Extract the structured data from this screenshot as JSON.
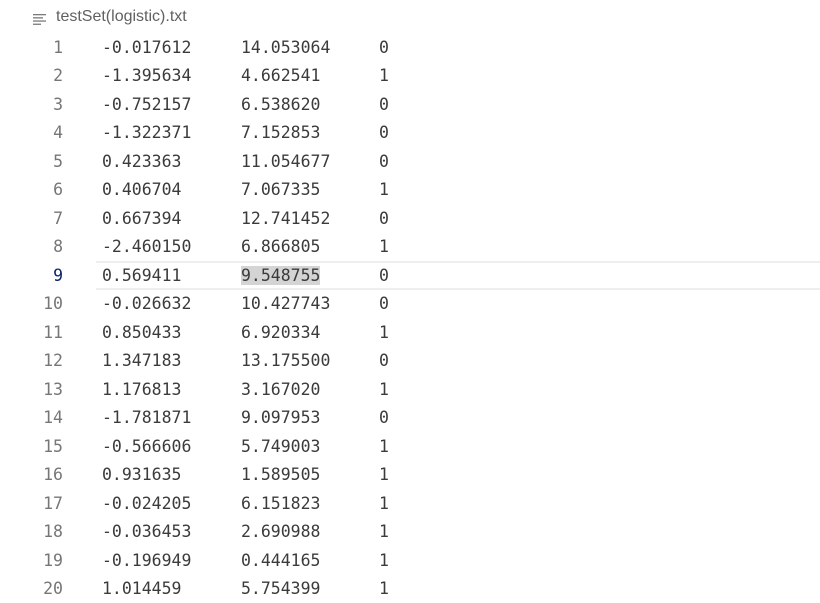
{
  "breadcrumb": {
    "icon": "text-lines-icon",
    "filename": "testSet(logistic).txt"
  },
  "editor": {
    "current_line": 9,
    "selection": "9.548755",
    "lines": [
      {
        "n": "1",
        "a": "-0.017612",
        "b": "14.053064",
        "c": "0"
      },
      {
        "n": "2",
        "a": "-1.395634",
        "b": "4.662541",
        "c": "1"
      },
      {
        "n": "3",
        "a": "-0.752157",
        "b": "6.538620",
        "c": "0"
      },
      {
        "n": "4",
        "a": "-1.322371",
        "b": "7.152853",
        "c": "0"
      },
      {
        "n": "5",
        "a": "0.423363",
        "b": "11.054677",
        "c": "0"
      },
      {
        "n": "6",
        "a": "0.406704",
        "b": "7.067335",
        "c": "1"
      },
      {
        "n": "7",
        "a": "0.667394",
        "b": "12.741452",
        "c": "0"
      },
      {
        "n": "8",
        "a": "-2.460150",
        "b": "6.866805",
        "c": "1"
      },
      {
        "n": "9",
        "a": "0.569411",
        "b": "9.548755",
        "c": "0"
      },
      {
        "n": "10",
        "a": "-0.026632",
        "b": "10.427743",
        "c": "0"
      },
      {
        "n": "11",
        "a": "0.850433",
        "b": "6.920334",
        "c": "1"
      },
      {
        "n": "12",
        "a": "1.347183",
        "b": "13.175500",
        "c": "0"
      },
      {
        "n": "13",
        "a": "1.176813",
        "b": "3.167020",
        "c": "1"
      },
      {
        "n": "14",
        "a": "-1.781871",
        "b": "9.097953",
        "c": "0"
      },
      {
        "n": "15",
        "a": "-0.566606",
        "b": "5.749003",
        "c": "1"
      },
      {
        "n": "16",
        "a": "0.931635",
        "b": "1.589505",
        "c": "1"
      },
      {
        "n": "17",
        "a": "-0.024205",
        "b": "6.151823",
        "c": "1"
      },
      {
        "n": "18",
        "a": "-0.036453",
        "b": "2.690988",
        "c": "1"
      },
      {
        "n": "19",
        "a": "-0.196949",
        "b": "0.444165",
        "c": "1"
      },
      {
        "n": "20",
        "a": "1.014459",
        "b": "5.754399",
        "c": "1"
      }
    ]
  }
}
